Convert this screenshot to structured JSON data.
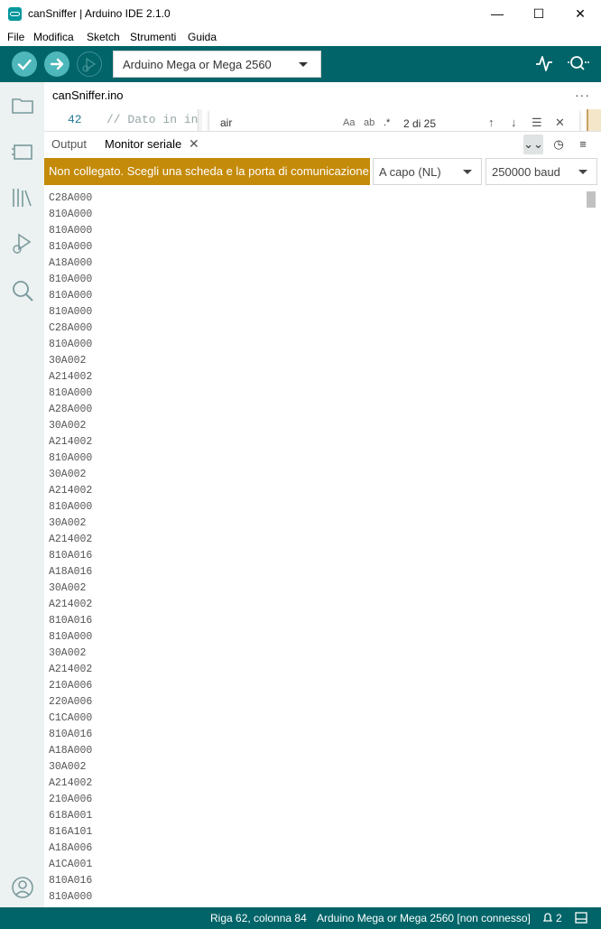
{
  "window": {
    "title": "canSniffer | Arduino IDE 2.1.0",
    "minimize": "—",
    "maximize": "☐",
    "close": "✕"
  },
  "menu": [
    "File",
    "Modifica",
    "Sketch",
    "Strumenti",
    "Guida"
  ],
  "toolbar": {
    "board": "Arduino Mega or Mega 2560",
    "verify_icon": "check-icon",
    "upload_icon": "arrow-right-icon",
    "debug_icon": "debug-icon",
    "plotter_icon": "serial-plotter-icon",
    "monitor_icon": "serial-monitor-icon",
    "accent": "#006468",
    "button_color": "#4db7bb"
  },
  "sidebar": [
    "folder-icon",
    "board-icon",
    "library-icon",
    "debug-icon",
    "search-icon",
    "account-icon"
  ],
  "editor": {
    "tab": "canSniffer.ino",
    "more": "···",
    "line_number": "42",
    "code_line": "// Dato in in",
    "find": {
      "value": "air",
      "match_case": "Aa",
      "whole_word": "ab",
      "regex": ".*",
      "count": "2 di 25",
      "prev": "↑",
      "next": "↓",
      "selection": "☰",
      "close": "✕"
    }
  },
  "panel": {
    "tab_output": "Output",
    "tab_monitor": "Monitor seriale",
    "tab_close": "✕",
    "autoscroll": "⌄⌄",
    "timestamp": "◷",
    "clear": "≡"
  },
  "monitor": {
    "notice": "Non collegato. Scegli una scheda e la porta di comunicazione",
    "notice_color": "#c48a09",
    "line_ending": "A capo (NL)",
    "baud": "250000 baud",
    "lines": [
      "C28A000",
      "810A000",
      "810A000",
      "810A000",
      "A18A000",
      "810A000",
      "810A000",
      "810A000",
      "C28A000",
      "810A000",
      "30A002",
      "A214002",
      "810A000",
      "A28A000",
      "30A002",
      "A214002",
      "810A000",
      "30A002",
      "A214002",
      "810A000",
      "30A002",
      "A214002",
      "810A016",
      "A18A016",
      "30A002",
      "A214002",
      "810A016",
      "810A000",
      "30A002",
      "A214002",
      "210A006",
      "220A006",
      "C1CA000",
      "810A016",
      "A18A000",
      "30A002",
      "A214002",
      "210A006",
      "618A001",
      "816A101",
      "A18A006",
      "A1CA001",
      "810A016",
      "810A000"
    ]
  },
  "status": {
    "position": "Riga 62, colonna 84",
    "board": "Arduino Mega or Mega 2560 [non connesso]",
    "notifications": "2",
    "bell_icon": "bell-icon",
    "layout_icon": "panel-toggle-icon"
  }
}
